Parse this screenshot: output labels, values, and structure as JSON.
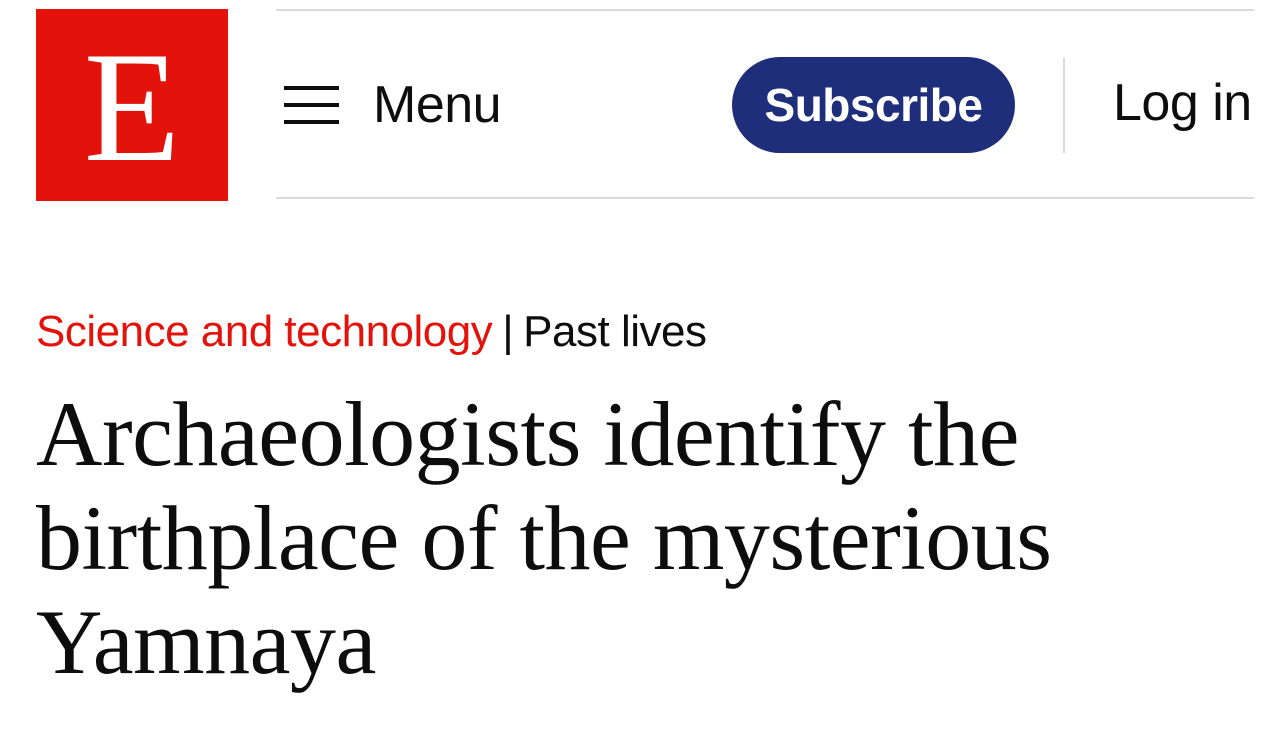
{
  "brand": {
    "logo_letter": "E",
    "accent_color": "#e3120b"
  },
  "header": {
    "menu_label": "Menu",
    "menu_icon": "hamburger-icon",
    "subscribe_label": "Subscribe",
    "subscribe_color": "#1f2e7a",
    "login_label": "Log in"
  },
  "article": {
    "section": "Science and technology",
    "separator": "|",
    "rubric": "Past lives",
    "headline": "Archaeologists identify the birthplace of the mysterious Yamnaya"
  }
}
